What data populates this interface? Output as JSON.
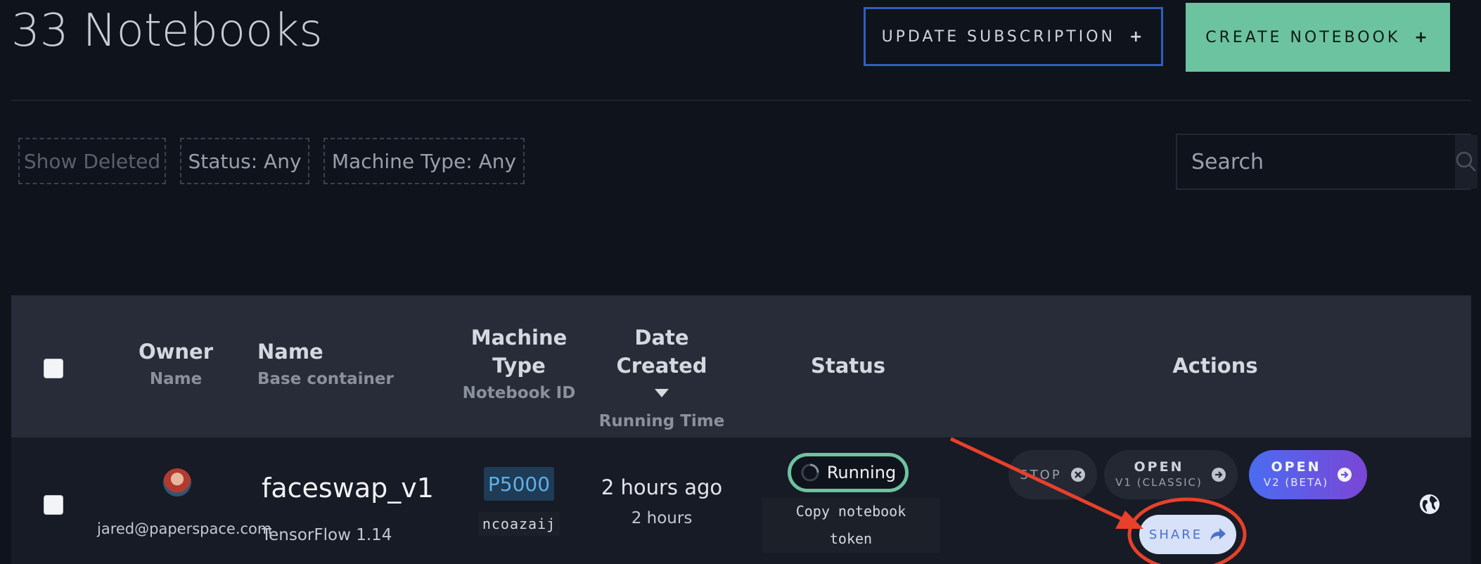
{
  "page": {
    "title": "33 Notebooks"
  },
  "header": {
    "update_label": "UPDATE SUBSCRIPTION",
    "create_label": "CREATE NOTEBOOK",
    "plus": "+"
  },
  "filters": {
    "show_deleted": "Show Deleted",
    "status": "Status: Any",
    "machine_type": "Machine Type: Any"
  },
  "search": {
    "placeholder": "Search"
  },
  "table": {
    "headers": {
      "owner": "Owner",
      "owner_sub": "Name",
      "name": "Name",
      "name_sub": "Base container",
      "machine_1": "Machine",
      "machine_2": "Type",
      "machine_sub": "Notebook ID",
      "date": "Date Created",
      "date_sub": "Running Time",
      "status": "Status",
      "actions": "Actions"
    },
    "row": {
      "owner_email": "jared@paperspace.com",
      "name": "faceswap_v1",
      "container": "TensorFlow 1.14",
      "machine": "P5000",
      "notebook_id": "ncoazaij",
      "date": "2 hours ago",
      "running_time": "2 hours",
      "status": "Running",
      "copy_token_1": "Copy notebook",
      "copy_token_2": "token"
    },
    "actions": {
      "stop": "STOP",
      "open_v1": "OPEN",
      "open_v1_sub": "V1 (CLASSIC)",
      "open_v2": "OPEN",
      "open_v2_sub": "V2 (BETA)",
      "share": "SHARE"
    }
  },
  "colors": {
    "accent_green": "#6cc3a0",
    "accent_blue": "#2f5fc0",
    "annotation_red": "#e8402a"
  }
}
